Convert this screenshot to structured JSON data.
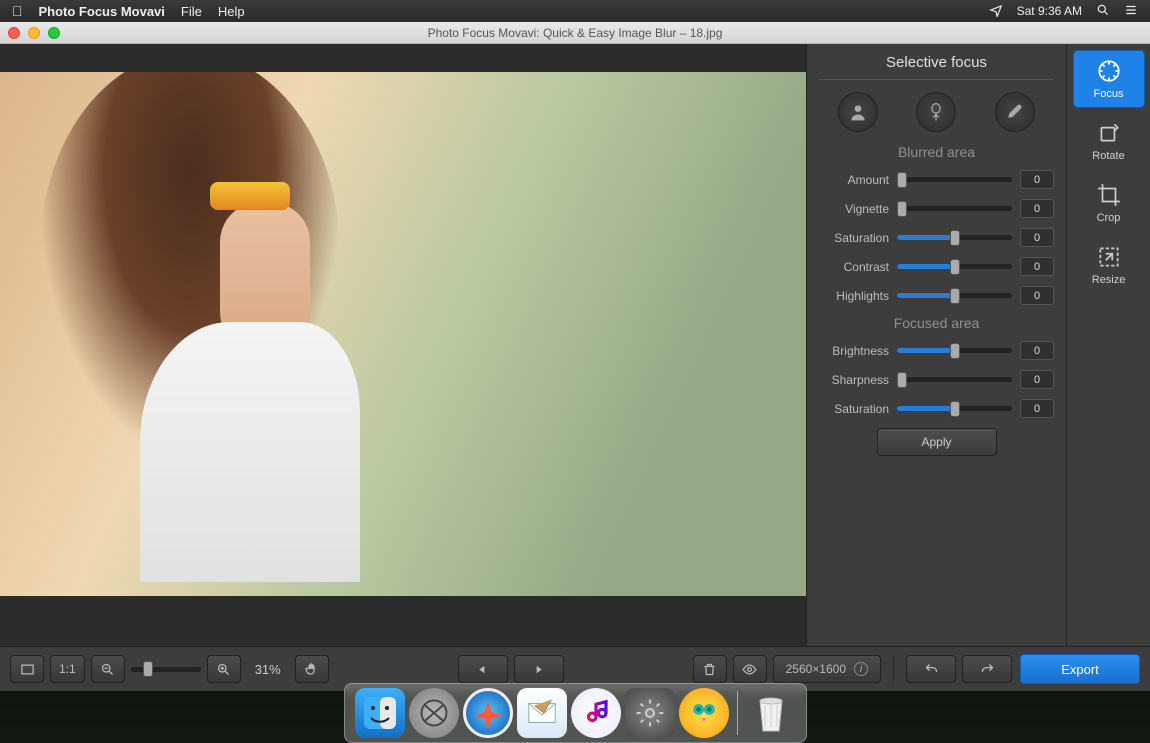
{
  "menubar": {
    "app": "Photo Focus Movavi",
    "items": [
      "File",
      "Help"
    ],
    "clock": "Sat 9:36 AM"
  },
  "window": {
    "title": "Photo Focus Movavi: Quick & Easy Image Blur – 18.jpg"
  },
  "panel": {
    "title": "Selective focus",
    "modes": {
      "portrait": "Portrait",
      "macro": "Macro",
      "brush": "Brush"
    },
    "blurred": {
      "title": "Blurred area",
      "sliders": [
        {
          "label": "Amount",
          "value": "0",
          "fill": 0,
          "thumb": 4
        },
        {
          "label": "Vignette",
          "value": "0",
          "fill": 0,
          "thumb": 4
        },
        {
          "label": "Saturation",
          "value": "0",
          "fill": 50,
          "thumb": 50
        },
        {
          "label": "Contrast",
          "value": "0",
          "fill": 50,
          "thumb": 50
        },
        {
          "label": "Highlights",
          "value": "0",
          "fill": 50,
          "thumb": 50
        }
      ]
    },
    "focused": {
      "title": "Focused area",
      "sliders": [
        {
          "label": "Brightness",
          "value": "0",
          "fill": 50,
          "thumb": 50
        },
        {
          "label": "Sharpness",
          "value": "0",
          "fill": 0,
          "thumb": 4
        },
        {
          "label": "Saturation",
          "value": "0",
          "fill": 50,
          "thumb": 50
        }
      ]
    },
    "apply": "Apply"
  },
  "tools": [
    {
      "id": "focus",
      "label": "Focus",
      "active": true
    },
    {
      "id": "rotate",
      "label": "Rotate",
      "active": false
    },
    {
      "id": "crop",
      "label": "Crop",
      "active": false
    },
    {
      "id": "resize",
      "label": "Resize",
      "active": false
    }
  ],
  "bottom": {
    "ratio": "1:1",
    "zoom_pct": "31%",
    "dims": "2560×1600",
    "export": "Export"
  },
  "colors": {
    "accent": "#1f82e8"
  }
}
